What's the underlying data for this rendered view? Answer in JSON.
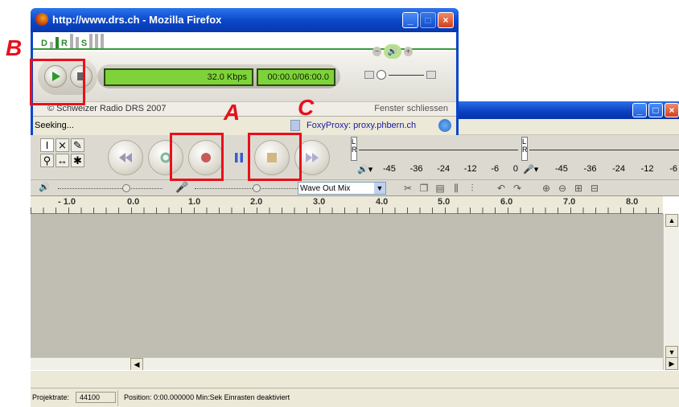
{
  "firefox": {
    "title": "http://www.drs.ch - Mozilla Firefox",
    "logo_letters": [
      "D",
      "R",
      "S"
    ],
    "bitrate": "32.0 Kbps",
    "time": "00:00.0/06:00.0",
    "copyright": "© Schweizer Radio DRS 2007",
    "close_window": "Fenster schliessen",
    "status": "Seeking...",
    "proxy": "FoxyProxy: proxy.phbern.ch",
    "volume_minus": "−",
    "volume_plus": "+"
  },
  "audacity": {
    "meter_left": "L",
    "meter_right": "R",
    "playback_scale": [
      "-45",
      "-36",
      "-24",
      "-12",
      "-6",
      "0"
    ],
    "record_scale": [
      "-45",
      "-36",
      "-24",
      "-12",
      "-6"
    ],
    "input_source": "Wave Out Mix",
    "ruler": [
      "- 1.0",
      "0.0",
      "1.0",
      "2.0",
      "3.0",
      "4.0",
      "5.0",
      "6.0",
      "7.0",
      "8.0"
    ],
    "status_rate_label": "Projektrate:",
    "status_rate_value": "44100",
    "status_text": "Position: 0:00.000000 Min:Sek   Einrasten deaktiviert"
  },
  "annotations": {
    "a": "A",
    "b": "B",
    "c": "C"
  },
  "colors": {
    "annotation": "#e8101c",
    "lcd": "#7ed33a",
    "xp_blue": "#0a46c8",
    "track_bg": "#c0bdb3"
  }
}
